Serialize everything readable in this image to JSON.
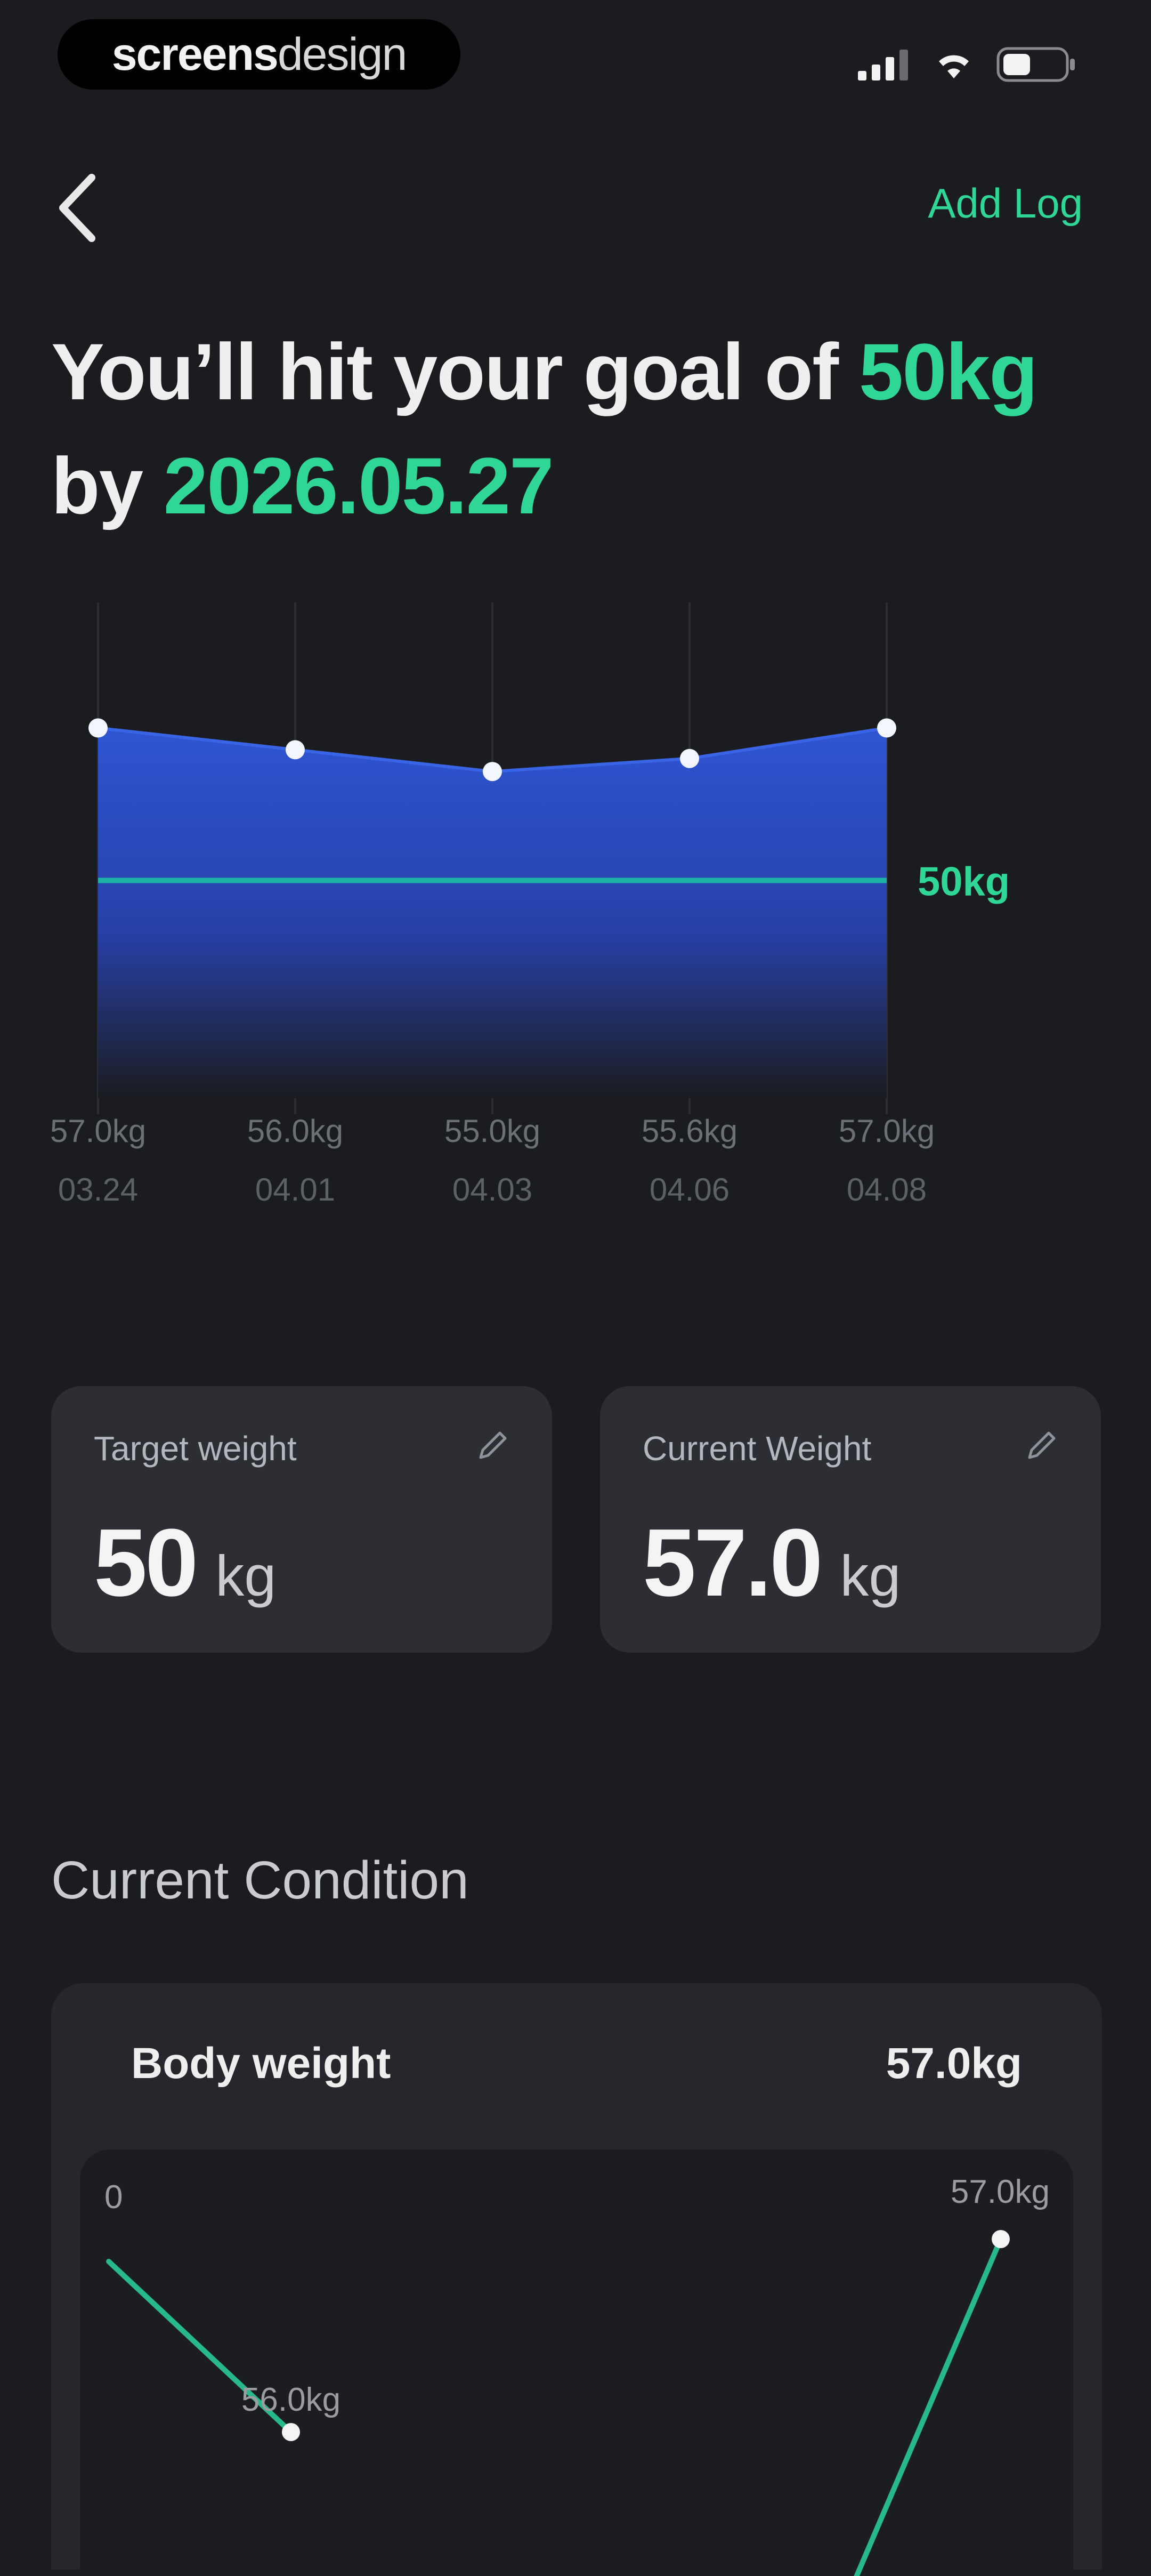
{
  "status_bar": {
    "brand_bold": "screens",
    "brand_light": "design",
    "icons": [
      "cellular-signal-icon",
      "wifi-icon",
      "battery-icon"
    ]
  },
  "header": {
    "back_icon": "chevron-left-icon",
    "add_log_label": "Add Log"
  },
  "headline": {
    "prefix": "You’ll hit your goal of ",
    "goal": "50kg",
    "by": "by ",
    "date": "2026.05.27"
  },
  "colors": {
    "accent": "#2fd696",
    "chart_fill_top": "#2e55d2",
    "chart_fill_bottom": "#1b1c20",
    "background": "#1b1c20",
    "card": "#2c2e34"
  },
  "chart_data": [
    {
      "type": "area",
      "x": [
        "03.24",
        "04.01",
        "04.03",
        "04.06",
        "04.08"
      ],
      "series": [
        {
          "values": [
            57.0,
            56.0,
            55.0,
            55.6,
            57.0
          ],
          "value_labels": [
            "57.0kg",
            "56.0kg",
            "55.0kg",
            "55.6kg",
            "57.0kg"
          ]
        }
      ],
      "goal_line": {
        "value": 50,
        "label": "50kg"
      },
      "grid": "vertical",
      "ylim": [
        40,
        63.5
      ]
    },
    {
      "type": "line",
      "x": [
        "",
        "",
        "",
        ""
      ],
      "series": [
        {
          "values": [
            0,
            56.0,
            0,
            57.0
          ],
          "value_labels": [
            "0",
            "56.0kg",
            "",
            "57.0kg"
          ]
        }
      ]
    }
  ],
  "cards": [
    {
      "label": "Target weight",
      "value": "50",
      "unit": "kg",
      "edit_icon": "pencil-icon"
    },
    {
      "label": "Current Weight",
      "value": "57.0",
      "unit": "kg",
      "edit_icon": "pencil-icon"
    }
  ],
  "section_title": "Current Condition",
  "condition": {
    "label": "Body weight",
    "value": "57.0kg"
  }
}
